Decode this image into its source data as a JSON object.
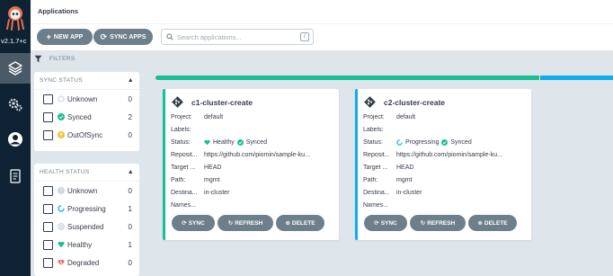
{
  "nav": {
    "version": "v2.1.7+c",
    "items": [
      "applications",
      "settings",
      "user-info",
      "documentation"
    ]
  },
  "header": {
    "title": "Applications"
  },
  "toolbar": {
    "new_app_label": "NEW APP",
    "sync_apps_label": "SYNC APPS",
    "search_placeholder": "Search applications...",
    "search_shortcut": "/"
  },
  "filters": {
    "title": "FILTERS",
    "sync_status": {
      "title": "SYNC STATUS",
      "items": [
        {
          "label": "Unknown",
          "count": "0",
          "icon": "circle-outline-icon",
          "color": "#ccd6dd"
        },
        {
          "label": "Synced",
          "count": "2",
          "icon": "check-circle-icon",
          "color": "#18be94"
        },
        {
          "label": "OutOfSync",
          "count": "0",
          "icon": "arrow-up-circle-icon",
          "color": "#f4c030"
        }
      ]
    },
    "health_status": {
      "title": "HEALTH STATUS",
      "items": [
        {
          "label": "Unknown",
          "count": "0",
          "icon": "question-circle-icon",
          "color": "#ccd6dd"
        },
        {
          "label": "Progressing",
          "count": "1",
          "icon": "progress-circle-icon",
          "color": "#0dadea"
        },
        {
          "label": "Suspended",
          "count": "0",
          "icon": "pause-circle-icon",
          "color": "#766f94"
        },
        {
          "label": "Healthy",
          "count": "1",
          "icon": "heart-icon",
          "color": "#18be94"
        },
        {
          "label": "Degraded",
          "count": "0",
          "icon": "broken-heart-icon",
          "color": "#e96d76"
        }
      ]
    }
  },
  "status_bar": {
    "healthy_fraction": 0.84,
    "progressing_fraction": 0.16
  },
  "apps": [
    {
      "name": "c1-cluster-create",
      "accent": "#18be94",
      "fields": [
        {
          "key": "Project:",
          "value": "default"
        },
        {
          "key": "Labels:",
          "value": ""
        },
        {
          "key": "Status:",
          "health": "Healthy",
          "sync": "Synced"
        },
        {
          "key": "Reposit...",
          "value": "https://github.com/piomin/sample-ku..."
        },
        {
          "key": "Target ...",
          "value": "HEAD"
        },
        {
          "key": "Path:",
          "value": "mgmt"
        },
        {
          "key": "Destina...",
          "value": "in-cluster"
        },
        {
          "key": "Names...",
          "value": ""
        }
      ],
      "actions": {
        "sync": "SYNC",
        "refresh": "REFRESH",
        "delete": "DELETE"
      }
    },
    {
      "name": "c2-cluster-create",
      "accent": "#0dadea",
      "fields": [
        {
          "key": "Project:",
          "value": "default"
        },
        {
          "key": "Labels:",
          "value": ""
        },
        {
          "key": "Status:",
          "health": "Progressing",
          "sync": "Synced"
        },
        {
          "key": "Reposit...",
          "value": "https://github.com/piomin/sample-ku..."
        },
        {
          "key": "Target ...",
          "value": "HEAD"
        },
        {
          "key": "Path:",
          "value": "mgmt"
        },
        {
          "key": "Destina...",
          "value": "in-cluster"
        },
        {
          "key": "Names...",
          "value": ""
        }
      ],
      "actions": {
        "sync": "SYNC",
        "refresh": "REFRESH",
        "delete": "DELETE"
      }
    }
  ]
}
